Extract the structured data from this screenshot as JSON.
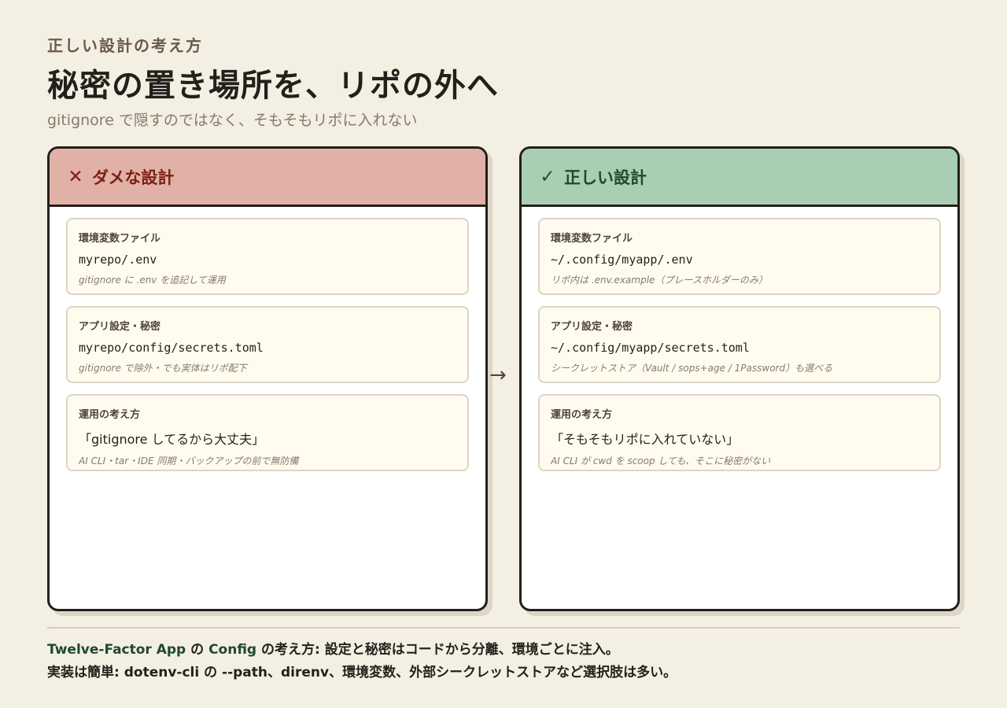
{
  "header": {
    "eyebrow": "正しい設計の考え方",
    "title": "秘密の置き場所を、リポの外へ",
    "subtitle": "gitignore で隠すのではなく、そもそもリポに入れない"
  },
  "bad_panel": {
    "icon": "cross-icon",
    "mark": "✕",
    "title": "ダメな設計",
    "cards": [
      {
        "label": "環境変数ファイル",
        "value": "myrepo/.env",
        "note": "gitignore に .env を追記して運用"
      },
      {
        "label": "アプリ設定・秘密",
        "value": "myrepo/config/secrets.toml",
        "note": "gitignore で除外・でも実体はリポ配下"
      },
      {
        "label": "運用の考え方",
        "value": "「gitignore してるから大丈夫」",
        "note": "AI CLI・tar・IDE 同期・バックアップの前で無防備"
      }
    ]
  },
  "good_panel": {
    "icon": "check-icon",
    "mark": "✓",
    "title": "正しい設計",
    "cards": [
      {
        "label": "環境変数ファイル",
        "value": "~/.config/myapp/.env",
        "note": "リポ内は .env.example（プレースホルダーのみ）"
      },
      {
        "label": "アプリ設定・秘密",
        "value": "~/.config/myapp/secrets.toml",
        "note": "シークレットストア（Vault / sops+age / 1Password）も選べる"
      },
      {
        "label": "運用の考え方",
        "value": "「そもそもリポに入れていない」",
        "note": "AI CLI が cwd を scoop しても、そこに秘密がない"
      }
    ]
  },
  "arrow": "→",
  "footer": {
    "line1_accent_a": "Twelve-Factor App",
    "line1_mid": " の ",
    "line1_accent_b": "Config",
    "line1_rest": " の考え方: 設定と秘密はコードから分離、環境ごとに注入。",
    "line2": "実装は簡単: dotenv-cli の --path、direnv、環境変数、外部シークレットストアなど選択肢は多い。"
  },
  "colors": {
    "background": "#f4efe3",
    "bad_header": "#e1b0a6",
    "good_header": "#a8cfb2",
    "card_background": "#fffcef"
  }
}
